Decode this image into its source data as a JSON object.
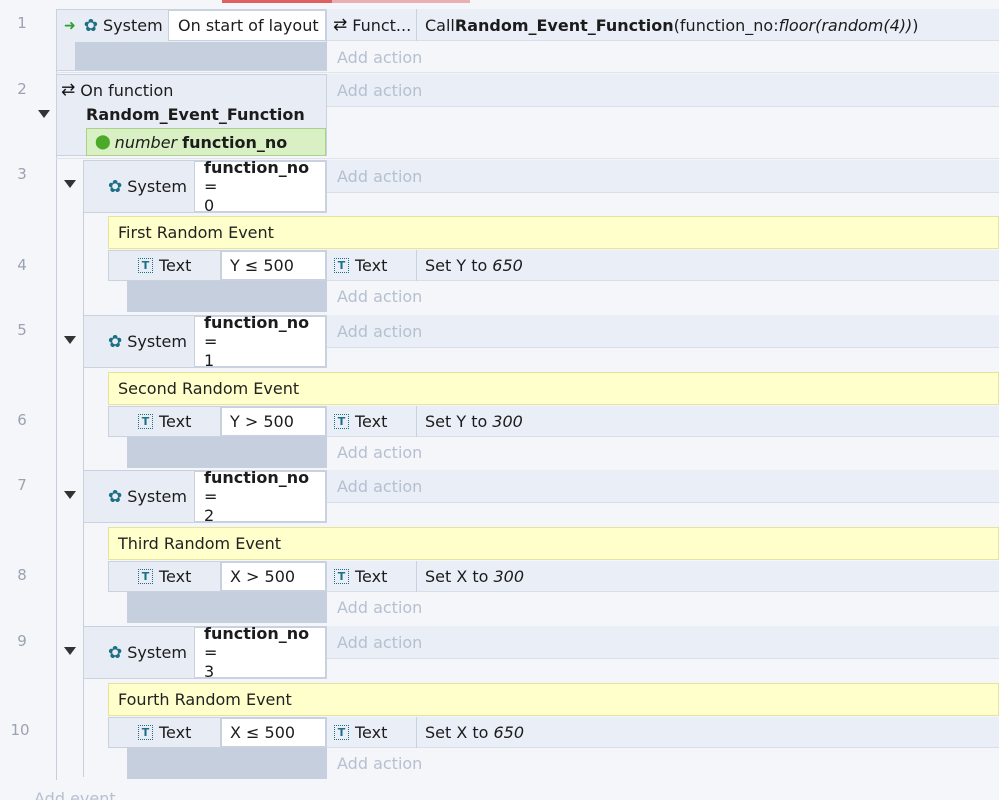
{
  "rows": [
    "1",
    "2",
    "3",
    "4",
    "5",
    "6",
    "7",
    "8",
    "9",
    "10"
  ],
  "event1": {
    "object": "System",
    "condition": "On start of layout",
    "action_object": "Funct...",
    "action_prefix": "Call ",
    "action_func": "Random_Event_Function",
    "action_args_open": " (function_no: ",
    "action_args_expr": "floor(random(4))",
    "action_args_close": ")"
  },
  "add_action": "Add action",
  "add_event": "Add event",
  "function_block": {
    "line1": "On function",
    "name": "Random_Event_Function",
    "param_type": "number",
    "param_name": "function_no"
  },
  "subevents": [
    {
      "cond_object": "System",
      "cond_var": "function_no",
      "cond_op": " =",
      "cond_value": "0",
      "comment": "First Random Event",
      "obj": "Text",
      "compare": "Y ≤ 500",
      "act_obj": "Text",
      "act_text": "Set Y to ",
      "act_value": "650"
    },
    {
      "cond_object": "System",
      "cond_var": "function_no",
      "cond_op": " =",
      "cond_value": "1",
      "comment": "Second Random Event",
      "obj": "Text",
      "compare": "Y > 500",
      "act_obj": "Text",
      "act_text": "Set Y to ",
      "act_value": "300"
    },
    {
      "cond_object": "System",
      "cond_var": "function_no",
      "cond_op": " =",
      "cond_value": "2",
      "comment": "Third Random Event",
      "obj": "Text",
      "compare": "X > 500",
      "act_obj": "Text",
      "act_text": "Set X to ",
      "act_value": "300"
    },
    {
      "cond_object": "System",
      "cond_var": "function_no",
      "cond_op": " =",
      "cond_value": "3",
      "comment": "Fourth Random Event",
      "obj": "Text",
      "compare": "X ≤ 500",
      "act_obj": "Text",
      "act_text": "Set X to ",
      "act_value": "650"
    }
  ],
  "icons": {
    "trigger": "green-arrow-icon",
    "system": "gear-icon",
    "function": "loop-icon",
    "text_object": "text-object-icon",
    "parameter": "pin-icon",
    "collapse": "collapse-triangle-icon"
  }
}
